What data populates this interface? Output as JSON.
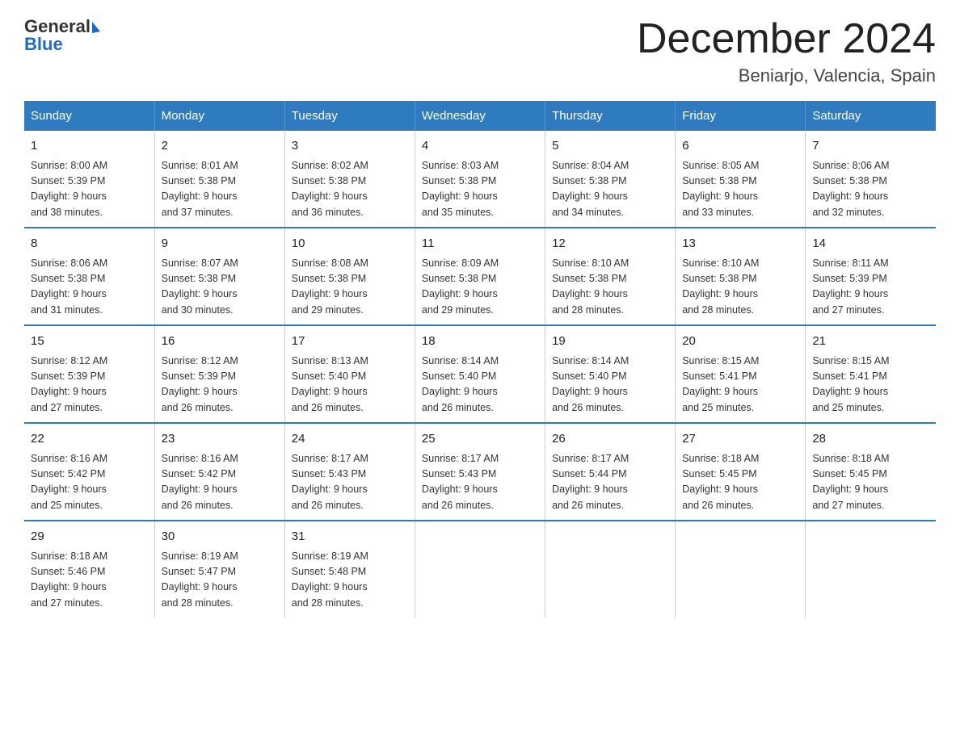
{
  "logo": {
    "general": "General",
    "blue": "Blue"
  },
  "header": {
    "title": "December 2024",
    "subtitle": "Beniarjo, Valencia, Spain"
  },
  "days_of_week": [
    "Sunday",
    "Monday",
    "Tuesday",
    "Wednesday",
    "Thursday",
    "Friday",
    "Saturday"
  ],
  "weeks": [
    [
      {
        "day": "1",
        "sunrise": "8:00 AM",
        "sunset": "5:39 PM",
        "daylight": "9 hours and 38 minutes."
      },
      {
        "day": "2",
        "sunrise": "8:01 AM",
        "sunset": "5:38 PM",
        "daylight": "9 hours and 37 minutes."
      },
      {
        "day": "3",
        "sunrise": "8:02 AM",
        "sunset": "5:38 PM",
        "daylight": "9 hours and 36 minutes."
      },
      {
        "day": "4",
        "sunrise": "8:03 AM",
        "sunset": "5:38 PM",
        "daylight": "9 hours and 35 minutes."
      },
      {
        "day": "5",
        "sunrise": "8:04 AM",
        "sunset": "5:38 PM",
        "daylight": "9 hours and 34 minutes."
      },
      {
        "day": "6",
        "sunrise": "8:05 AM",
        "sunset": "5:38 PM",
        "daylight": "9 hours and 33 minutes."
      },
      {
        "day": "7",
        "sunrise": "8:06 AM",
        "sunset": "5:38 PM",
        "daylight": "9 hours and 32 minutes."
      }
    ],
    [
      {
        "day": "8",
        "sunrise": "8:06 AM",
        "sunset": "5:38 PM",
        "daylight": "9 hours and 31 minutes."
      },
      {
        "day": "9",
        "sunrise": "8:07 AM",
        "sunset": "5:38 PM",
        "daylight": "9 hours and 30 minutes."
      },
      {
        "day": "10",
        "sunrise": "8:08 AM",
        "sunset": "5:38 PM",
        "daylight": "9 hours and 29 minutes."
      },
      {
        "day": "11",
        "sunrise": "8:09 AM",
        "sunset": "5:38 PM",
        "daylight": "9 hours and 29 minutes."
      },
      {
        "day": "12",
        "sunrise": "8:10 AM",
        "sunset": "5:38 PM",
        "daylight": "9 hours and 28 minutes."
      },
      {
        "day": "13",
        "sunrise": "8:10 AM",
        "sunset": "5:38 PM",
        "daylight": "9 hours and 28 minutes."
      },
      {
        "day": "14",
        "sunrise": "8:11 AM",
        "sunset": "5:39 PM",
        "daylight": "9 hours and 27 minutes."
      }
    ],
    [
      {
        "day": "15",
        "sunrise": "8:12 AM",
        "sunset": "5:39 PM",
        "daylight": "9 hours and 27 minutes."
      },
      {
        "day": "16",
        "sunrise": "8:12 AM",
        "sunset": "5:39 PM",
        "daylight": "9 hours and 26 minutes."
      },
      {
        "day": "17",
        "sunrise": "8:13 AM",
        "sunset": "5:40 PM",
        "daylight": "9 hours and 26 minutes."
      },
      {
        "day": "18",
        "sunrise": "8:14 AM",
        "sunset": "5:40 PM",
        "daylight": "9 hours and 26 minutes."
      },
      {
        "day": "19",
        "sunrise": "8:14 AM",
        "sunset": "5:40 PM",
        "daylight": "9 hours and 26 minutes."
      },
      {
        "day": "20",
        "sunrise": "8:15 AM",
        "sunset": "5:41 PM",
        "daylight": "9 hours and 25 minutes."
      },
      {
        "day": "21",
        "sunrise": "8:15 AM",
        "sunset": "5:41 PM",
        "daylight": "9 hours and 25 minutes."
      }
    ],
    [
      {
        "day": "22",
        "sunrise": "8:16 AM",
        "sunset": "5:42 PM",
        "daylight": "9 hours and 25 minutes."
      },
      {
        "day": "23",
        "sunrise": "8:16 AM",
        "sunset": "5:42 PM",
        "daylight": "9 hours and 26 minutes."
      },
      {
        "day": "24",
        "sunrise": "8:17 AM",
        "sunset": "5:43 PM",
        "daylight": "9 hours and 26 minutes."
      },
      {
        "day": "25",
        "sunrise": "8:17 AM",
        "sunset": "5:43 PM",
        "daylight": "9 hours and 26 minutes."
      },
      {
        "day": "26",
        "sunrise": "8:17 AM",
        "sunset": "5:44 PM",
        "daylight": "9 hours and 26 minutes."
      },
      {
        "day": "27",
        "sunrise": "8:18 AM",
        "sunset": "5:45 PM",
        "daylight": "9 hours and 26 minutes."
      },
      {
        "day": "28",
        "sunrise": "8:18 AM",
        "sunset": "5:45 PM",
        "daylight": "9 hours and 27 minutes."
      }
    ],
    [
      {
        "day": "29",
        "sunrise": "8:18 AM",
        "sunset": "5:46 PM",
        "daylight": "9 hours and 27 minutes."
      },
      {
        "day": "30",
        "sunrise": "8:19 AM",
        "sunset": "5:47 PM",
        "daylight": "9 hours and 28 minutes."
      },
      {
        "day": "31",
        "sunrise": "8:19 AM",
        "sunset": "5:48 PM",
        "daylight": "9 hours and 28 minutes."
      },
      {
        "day": "",
        "sunrise": "",
        "sunset": "",
        "daylight": ""
      },
      {
        "day": "",
        "sunrise": "",
        "sunset": "",
        "daylight": ""
      },
      {
        "day": "",
        "sunrise": "",
        "sunset": "",
        "daylight": ""
      },
      {
        "day": "",
        "sunrise": "",
        "sunset": "",
        "daylight": ""
      }
    ]
  ],
  "labels": {
    "sunrise": "Sunrise:",
    "sunset": "Sunset:",
    "daylight": "Daylight:"
  }
}
